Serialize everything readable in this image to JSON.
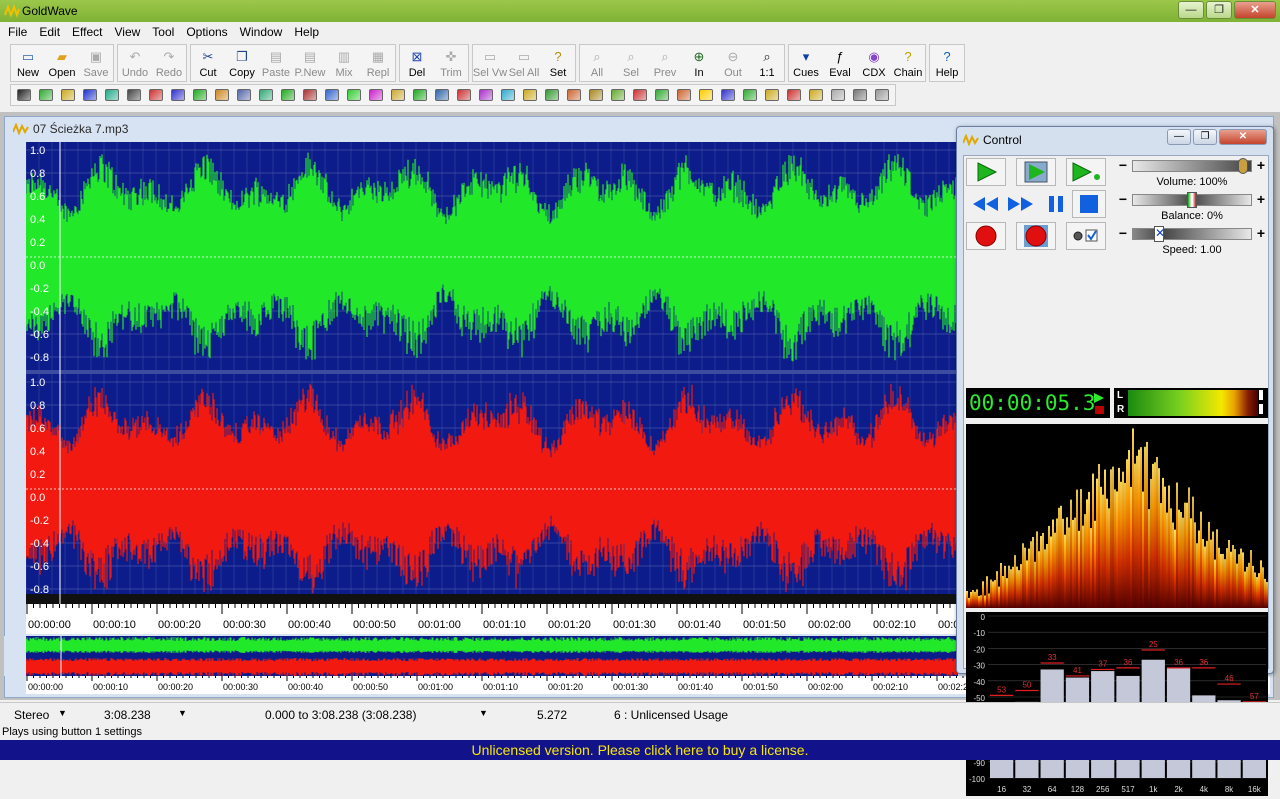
{
  "app": {
    "title": "GoldWave"
  },
  "window_controls": {
    "minimize": "—",
    "maximize": "❐",
    "close": "✕"
  },
  "menu": [
    "File",
    "Edit",
    "Effect",
    "View",
    "Tool",
    "Options",
    "Window",
    "Help"
  ],
  "toolbar": {
    "groups": [
      [
        {
          "label": "New",
          "icon": "new-file-icon"
        },
        {
          "label": "Open",
          "icon": "open-folder-icon"
        },
        {
          "label": "Save",
          "icon": "save-icon",
          "disabled": true
        }
      ],
      [
        {
          "label": "Undo",
          "icon": "undo-icon",
          "disabled": true
        },
        {
          "label": "Redo",
          "icon": "redo-icon",
          "disabled": true
        }
      ],
      [
        {
          "label": "Cut",
          "icon": "cut-icon"
        },
        {
          "label": "Copy",
          "icon": "copy-icon"
        },
        {
          "label": "Paste",
          "icon": "paste-icon",
          "disabled": true
        },
        {
          "label": "P.New",
          "icon": "paste-new-icon",
          "disabled": true
        },
        {
          "label": "Mix",
          "icon": "mix-icon",
          "disabled": true
        },
        {
          "label": "Repl",
          "icon": "replace-icon",
          "disabled": true
        }
      ],
      [
        {
          "label": "Del",
          "icon": "delete-icon"
        },
        {
          "label": "Trim",
          "icon": "trim-icon",
          "disabled": true
        }
      ],
      [
        {
          "label": "Sel Vw",
          "icon": "select-view-icon",
          "disabled": true
        },
        {
          "label": "Sel All",
          "icon": "select-all-icon",
          "disabled": true
        },
        {
          "label": "Set",
          "icon": "set-marker-icon"
        }
      ],
      [
        {
          "label": "All",
          "icon": "zoom-all-icon",
          "disabled": true
        },
        {
          "label": "Sel",
          "icon": "zoom-selection-icon",
          "disabled": true
        },
        {
          "label": "Prev",
          "icon": "zoom-previous-icon",
          "disabled": true
        },
        {
          "label": "In",
          "icon": "zoom-in-icon"
        },
        {
          "label": "Out",
          "icon": "zoom-out-icon",
          "disabled": true
        },
        {
          "label": "1:1",
          "icon": "zoom-one-to-one-icon"
        }
      ],
      [
        {
          "label": "Cues",
          "icon": "cues-icon"
        },
        {
          "label": "Eval",
          "icon": "eval-icon"
        },
        {
          "label": "CDX",
          "icon": "cd-extract-icon"
        },
        {
          "label": "Chain",
          "icon": "chain-icon"
        }
      ],
      [
        {
          "label": "Help",
          "icon": "help-icon"
        }
      ]
    ]
  },
  "effects_toolbar_icon_count": 40,
  "document": {
    "title": "07 Ścieżka 7.mp3",
    "amplitude_labels": [
      "1.0",
      "0.8",
      "0.6",
      "0.4",
      "0.2",
      "0.0",
      "-0.2",
      "-0.4",
      "-0.6",
      "-0.8"
    ],
    "timeline_labels": [
      "00:00:00",
      "00:00:10",
      "00:00:20",
      "00:00:30",
      "00:00:40",
      "00:00:50",
      "00:01:00",
      "00:01:10",
      "00:01:20",
      "00:01:30",
      "00:01:40",
      "00:01:50",
      "00:02:00",
      "00:02:10",
      "00:0"
    ],
    "overview_labels": [
      "00:00:00",
      "00:00:10",
      "00:00:20",
      "00:00:30",
      "00:00:40",
      "00:00:50",
      "00:01:00",
      "00:01:10",
      "00:01:20",
      "00:01:30",
      "00:01:40",
      "00:01:50",
      "00:02:00",
      "00:02:10",
      "00:02:20",
      "00:02:30",
      "00:02:40",
      "00:02:50",
      "00:03:00"
    ],
    "colors": {
      "left_channel": "#22e82a",
      "right_channel": "#f21a10",
      "background": "#0c1c8a"
    }
  },
  "control": {
    "title": "Control",
    "volume_label": "Volume: 100%",
    "balance_label": "Balance: 0%",
    "speed_label": "Speed: 1.00",
    "time": "00:00:05.3",
    "meter_left": "L",
    "meter_right": "R",
    "spectrum_y_labels": [
      "0",
      "-10",
      "-20",
      "-30",
      "-40",
      "-50",
      "-60",
      "-70",
      "-80",
      "-90",
      "-100"
    ],
    "spectrum_x_labels": [
      "16",
      "32",
      "64",
      "128",
      "256",
      "517",
      "1k",
      "2k",
      "4k",
      "8k",
      "16k"
    ],
    "spectrum_peaks": [
      "53",
      "50",
      "33",
      "41",
      "37",
      "36",
      "25",
      "36",
      "36",
      "46",
      "57"
    ],
    "spectrum_values": [
      56,
      53,
      33,
      38,
      34,
      37,
      27,
      32,
      49,
      52,
      59
    ]
  },
  "status": {
    "channels": "Stereo",
    "length": "3:08.238",
    "selection": "0.000 to 3:08.238 (3:08.238)",
    "position": "5.272",
    "license_status": "6 : Unlicensed Usage",
    "hint": "Plays using button 1 settings"
  },
  "license_banner": "Unlicensed version. Please click here to buy a license."
}
